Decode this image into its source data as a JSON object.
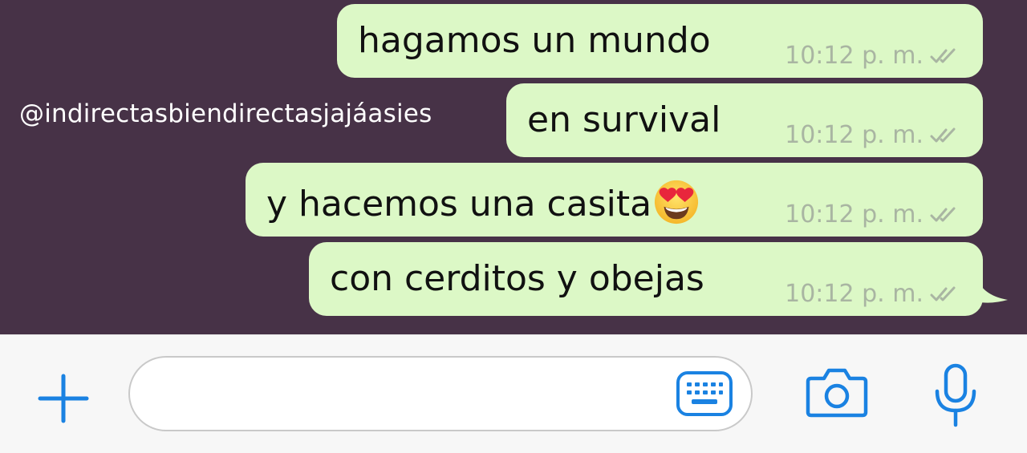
{
  "watermark": "@indirectasbiendirectasjajáasies",
  "messages": [
    {
      "text": "hagamos un mundo",
      "time": "10:12 p. m.",
      "status_icon": "double-check-icon"
    },
    {
      "text": "en survival",
      "time": "10:12 p. m.",
      "status_icon": "double-check-icon"
    },
    {
      "text": "y hacemos una casita",
      "emoji": "heart-eyes-emoji",
      "time": "10:12 p. m.",
      "status_icon": "double-check-icon"
    },
    {
      "text": "con cerditos y obejas",
      "time": "10:12 p. m.",
      "status_icon": "double-check-icon"
    }
  ],
  "input_bar": {
    "message_value": "",
    "icons": [
      "plus-icon",
      "keyboard-icon",
      "camera-icon",
      "microphone-icon"
    ]
  },
  "colors": {
    "chat_background": "#473247",
    "bubble_background": "#dcf8c6",
    "timestamp": "#a9b5a2",
    "accent_blue": "#1a82e2",
    "input_bar_background": "#f7f7f7"
  }
}
